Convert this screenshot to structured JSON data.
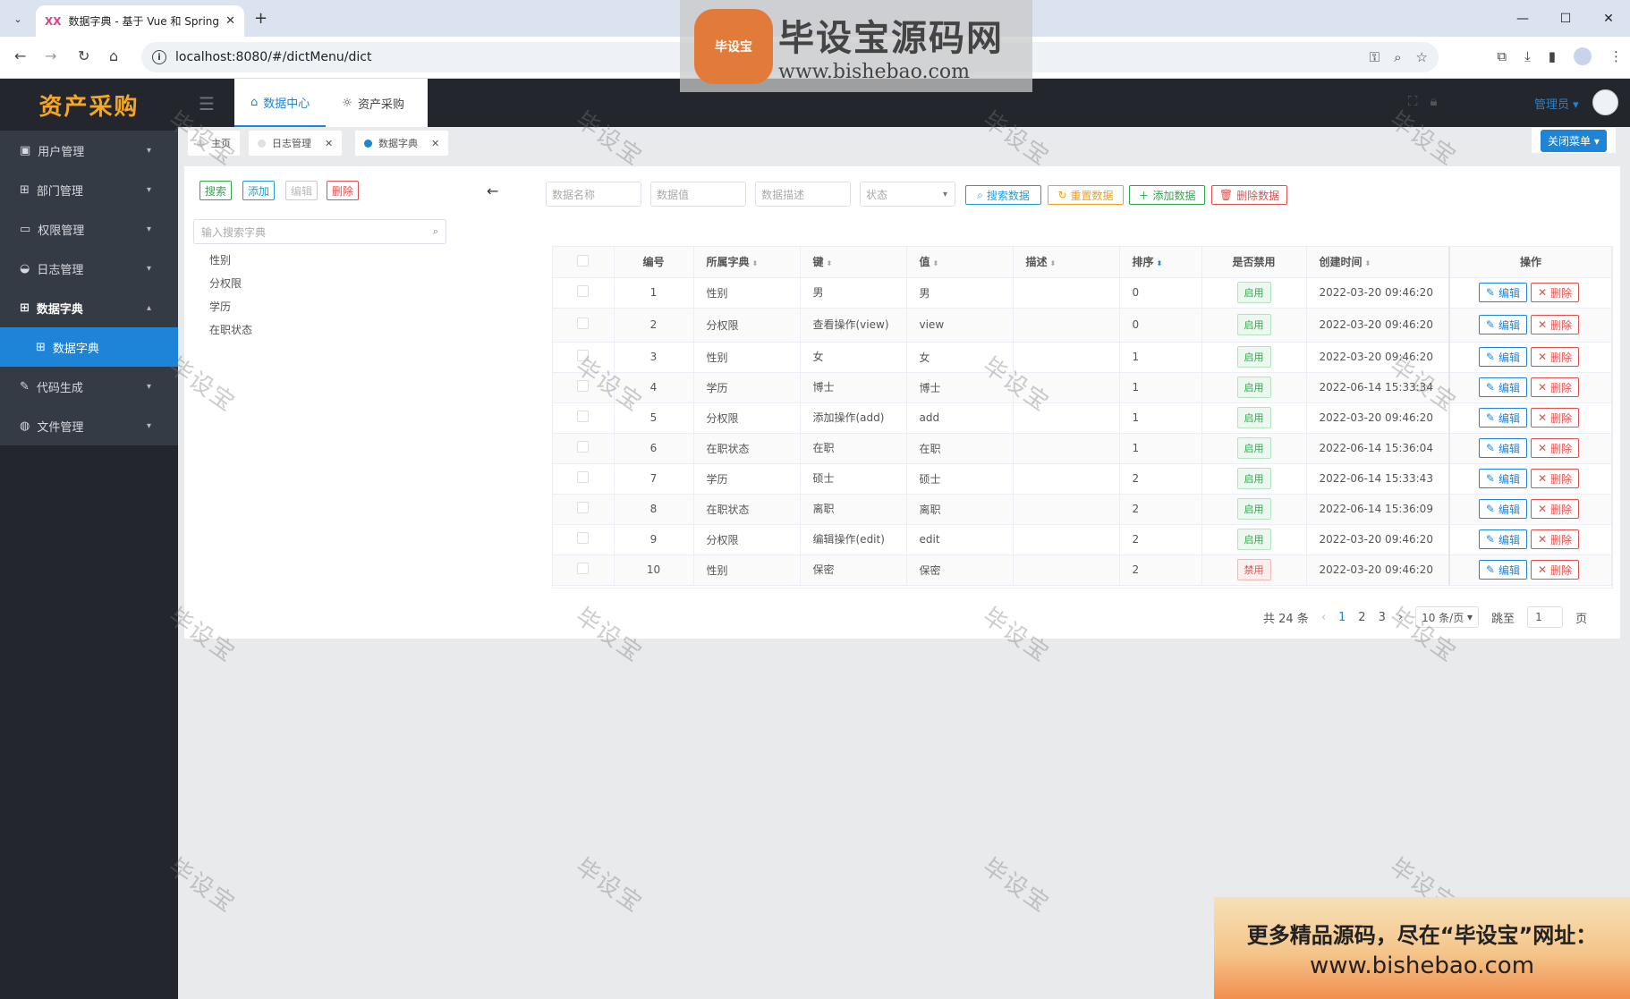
{
  "browser": {
    "tab_favicon": "XX",
    "tab_title": "数据字典 - 基于 Vue 和 Spring",
    "url": "localhost:8080/#/dictMenu/dict"
  },
  "watermark_banner": {
    "logo_text": "毕设宝",
    "title": "毕设宝源码网",
    "url": "www.bishebao.com"
  },
  "header": {
    "logo": "资产采购",
    "nav": [
      {
        "label": "数据中心"
      },
      {
        "label": "资产采购"
      }
    ],
    "user": "管理员"
  },
  "sidebar": {
    "items": [
      {
        "label": "用户管理"
      },
      {
        "label": "部门管理"
      },
      {
        "label": "权限管理"
      },
      {
        "label": "日志管理"
      },
      {
        "label": "数据字典"
      },
      {
        "label": "代码生成"
      },
      {
        "label": "文件管理"
      }
    ],
    "sub_active": "数据字典"
  },
  "page_tabs": [
    {
      "label": "主页"
    },
    {
      "label": "日志管理"
    },
    {
      "label": "数据字典"
    }
  ],
  "close_menu": "关闭菜单",
  "left_panel": {
    "buttons": {
      "search": "搜索",
      "add": "添加",
      "edit": "编辑",
      "delete": "删除"
    },
    "search_placeholder": "输入搜索字典",
    "tree": [
      "性别",
      "分权限",
      "学历",
      "在职状态"
    ]
  },
  "filters": {
    "name_placeholder": "数据名称",
    "value_placeholder": "数据值",
    "desc_placeholder": "数据描述",
    "status_placeholder": "状态",
    "btn_search": "搜索数据",
    "btn_reset": "重置数据",
    "btn_add": "添加数据",
    "btn_delete": "删除数据"
  },
  "table": {
    "headers": {
      "id": "编号",
      "dict": "所属字典",
      "key": "键",
      "value": "值",
      "desc": "描述",
      "sort": "排序",
      "disabled": "是否禁用",
      "created": "创建时间",
      "ops": "操作"
    },
    "edit_label": "编辑",
    "delete_label": "删除",
    "rows": [
      {
        "id": "1",
        "dict": "性别",
        "key": "男",
        "value": "男",
        "desc": "",
        "sort": "0",
        "status": "启用",
        "created": "2022-03-20 09:46:20"
      },
      {
        "id": "2",
        "dict": "分权限",
        "key": "查看操作(view)",
        "value": "view",
        "desc": "",
        "sort": "0",
        "status": "启用",
        "created": "2022-03-20 09:46:20"
      },
      {
        "id": "3",
        "dict": "性别",
        "key": "女",
        "value": "女",
        "desc": "",
        "sort": "1",
        "status": "启用",
        "created": "2022-03-20 09:46:20"
      },
      {
        "id": "4",
        "dict": "学历",
        "key": "博士",
        "value": "博士",
        "desc": "",
        "sort": "1",
        "status": "启用",
        "created": "2022-06-14 15:33:34"
      },
      {
        "id": "5",
        "dict": "分权限",
        "key": "添加操作(add)",
        "value": "add",
        "desc": "",
        "sort": "1",
        "status": "启用",
        "created": "2022-03-20 09:46:20"
      },
      {
        "id": "6",
        "dict": "在职状态",
        "key": "在职",
        "value": "在职",
        "desc": "",
        "sort": "1",
        "status": "启用",
        "created": "2022-06-14 15:36:04"
      },
      {
        "id": "7",
        "dict": "学历",
        "key": "硕士",
        "value": "硕士",
        "desc": "",
        "sort": "2",
        "status": "启用",
        "created": "2022-06-14 15:33:43"
      },
      {
        "id": "8",
        "dict": "在职状态",
        "key": "离职",
        "value": "离职",
        "desc": "",
        "sort": "2",
        "status": "启用",
        "created": "2022-06-14 15:36:09"
      },
      {
        "id": "9",
        "dict": "分权限",
        "key": "编辑操作(edit)",
        "value": "edit",
        "desc": "",
        "sort": "2",
        "status": "启用",
        "created": "2022-03-20 09:46:20"
      },
      {
        "id": "10",
        "dict": "性别",
        "key": "保密",
        "value": "保密",
        "desc": "",
        "sort": "2",
        "status": "禁用",
        "created": "2022-03-20 09:46:20"
      }
    ]
  },
  "pagination": {
    "total": "共 24 条",
    "pages": [
      "1",
      "2",
      "3"
    ],
    "page_size": "10 条/页",
    "jump_label": "跳至",
    "jump_value": "1",
    "page_suffix": "页"
  },
  "watermark_text": "毕设宝",
  "promo": {
    "line1": "更多精品源码，尽在“毕设宝”网址：",
    "line2": "www.bishebao.com"
  }
}
